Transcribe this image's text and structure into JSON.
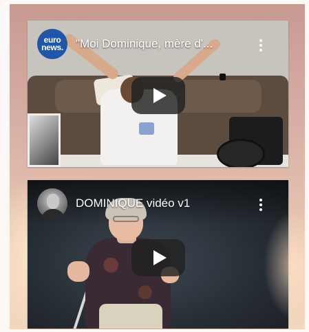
{
  "videos": [
    {
      "title": "\"Moi Dominique, mère d'...",
      "channel_avatar_lines": [
        "euro",
        "news."
      ],
      "avatar_icon": "euronews-logo-icon",
      "more_icon": "more-vert-icon",
      "play_icon": "play-icon"
    },
    {
      "title": "DOMINIQUE vidéo v1",
      "avatar_icon": "user-avatar-icon",
      "more_icon": "more-vert-icon",
      "play_icon": "play-icon"
    }
  ],
  "colors": {
    "background_gradient_top": "#c89a92",
    "background_gradient_bottom": "#f2d8bf",
    "euronews_blue": "#1f56a8",
    "play_button_bg": "#212121"
  }
}
